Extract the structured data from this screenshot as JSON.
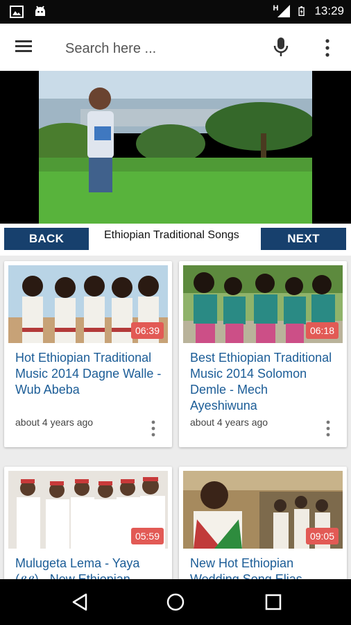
{
  "status_bar": {
    "time": "13:29",
    "network": "H",
    "icons": [
      "gallery-icon",
      "android-icon",
      "signal-icon",
      "battery-icon"
    ]
  },
  "app_bar": {
    "search_placeholder": "Search here ...",
    "menu_icon": "hamburger-menu-icon",
    "mic_icon": "microphone-icon",
    "more_icon": "more-vertical-icon"
  },
  "player_nav": {
    "back_label": "BACK",
    "next_label": "NEXT",
    "title": "Ethiopian Traditional Songs"
  },
  "videos": [
    {
      "title": "Hot Ethiopian Traditional Music 2014 Dagne Walle - Wub Abeba",
      "time_ago": "about 4 years ago",
      "duration": "06:39"
    },
    {
      "title": "Best Ethiopian Traditional Music 2014 Solomon Demle - Mech Ayeshiwuna",
      "time_ago": "about 4 years ago",
      "duration": "06:18"
    },
    {
      "title": "Mulugeta Lema - Yaya (ያያ) - New Ethiopian",
      "time_ago": "",
      "duration": "05:59"
    },
    {
      "title": "New Hot Ethiopian Wedding Song Elias",
      "time_ago": "",
      "duration": "09:05"
    }
  ],
  "colors": {
    "nav_button": "#17406d",
    "duration_badge": "#e25a55",
    "video_title": "#1c5d97"
  }
}
